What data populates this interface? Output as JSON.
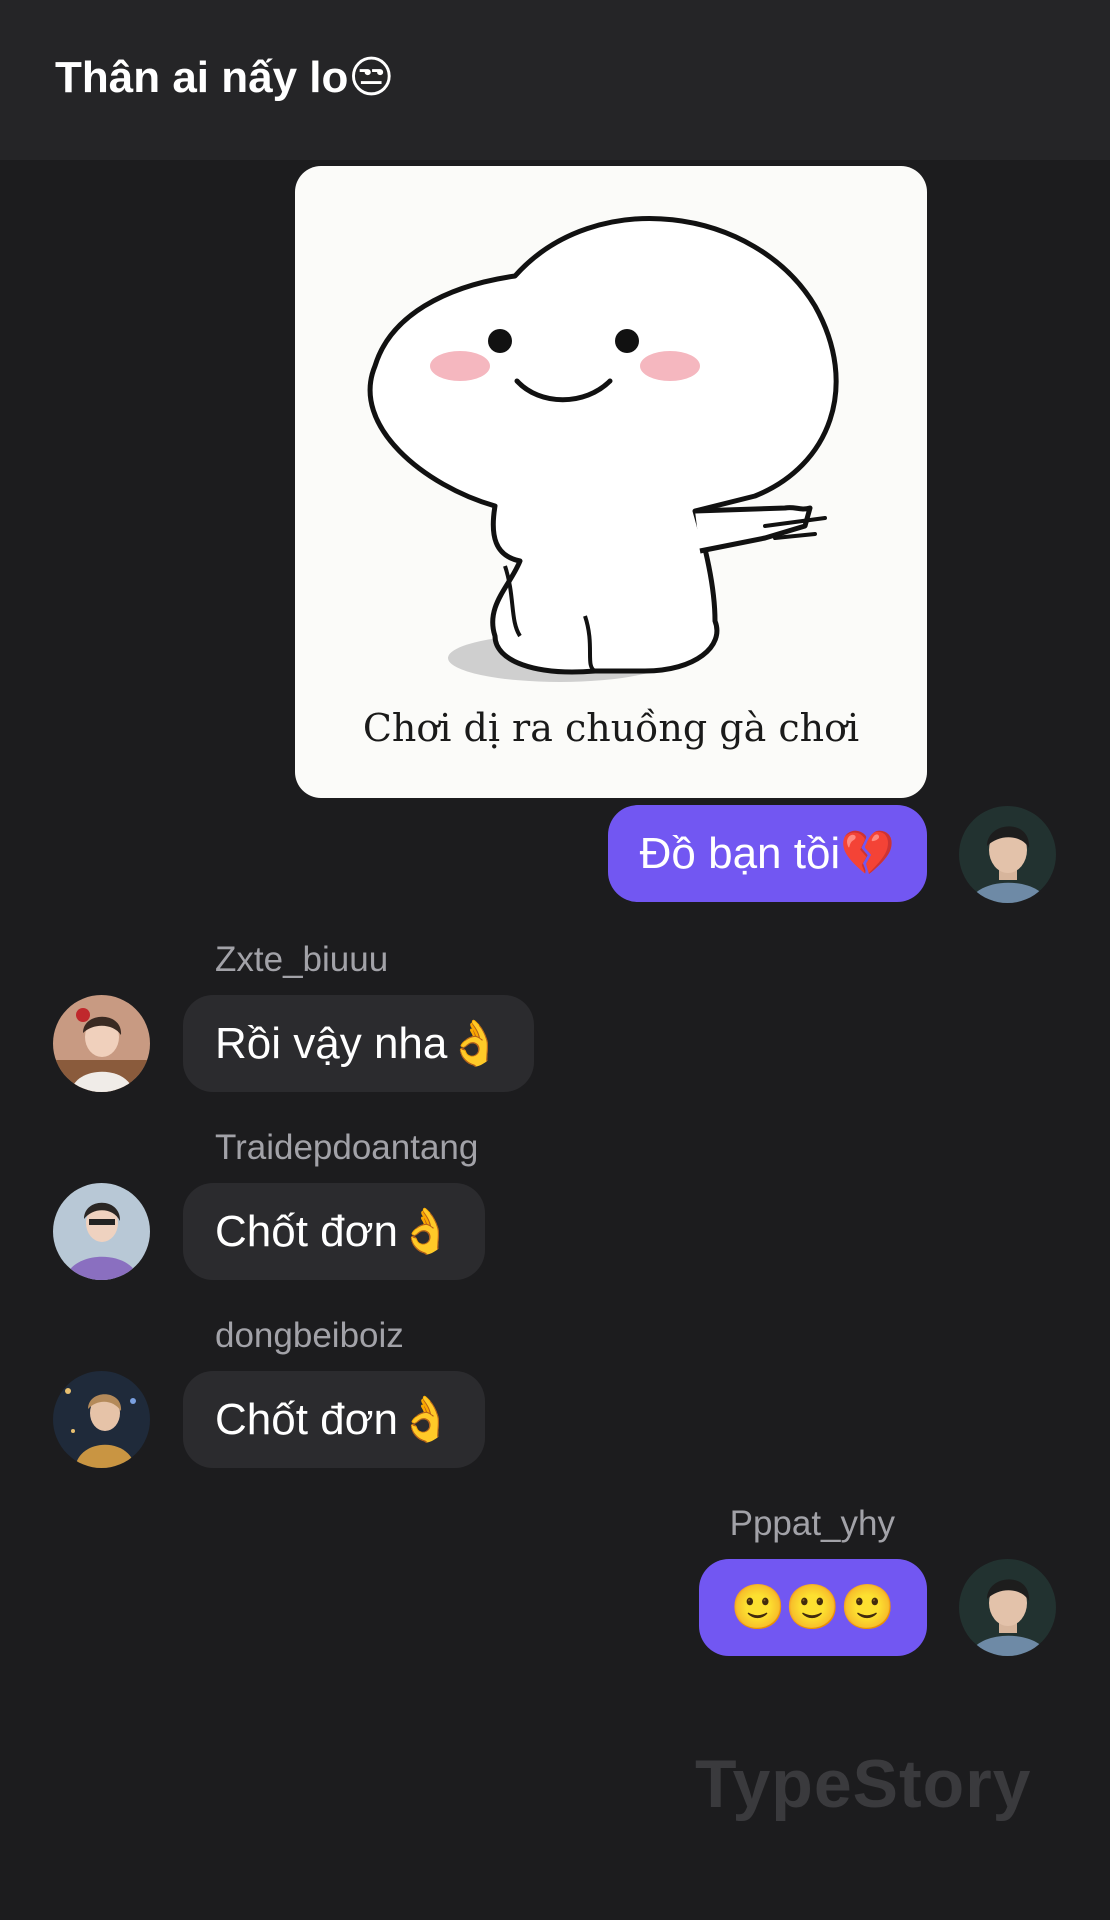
{
  "header": {
    "title": "Thân ai nấy lo😒"
  },
  "sticker": {
    "caption": "Chơi dị ra chuồng gà chơi"
  },
  "messages": [
    {
      "sender": "",
      "text": "Đồ bạn tồi💔",
      "outgoing": true
    },
    {
      "sender": "Zxte_biuuu",
      "text": "Rồi vậy nha👌",
      "outgoing": false
    },
    {
      "sender": "Traidepdoantang",
      "text": "Chốt đơn👌",
      "outgoing": false
    },
    {
      "sender": "dongbeiboiz",
      "text": "Chốt đơn👌",
      "outgoing": false
    },
    {
      "sender": "Pppat_yhy",
      "text": "🙂🙂🙂",
      "outgoing": true
    }
  ],
  "watermark": "TypeStory",
  "colors": {
    "outgoing_bubble": "#7257f2",
    "incoming_bubble": "#2b2b2e",
    "background": "#1c1c1e",
    "header": "#252527"
  }
}
